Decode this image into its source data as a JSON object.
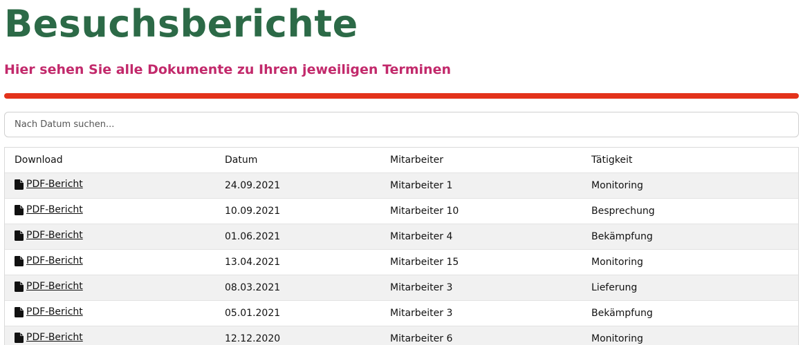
{
  "header": {
    "title": "Besuchsberichte",
    "subtitle": "Hier sehen Sie alle Dokumente zu Ihren jeweiligen Terminen"
  },
  "colors": {
    "title": "#2c6a47",
    "subtitle": "#c2296b",
    "divider": "#e3331b"
  },
  "search": {
    "placeholder": "Nach Datum suchen...",
    "value": ""
  },
  "table": {
    "columns": [
      "Download",
      "Datum",
      "Mitarbeiter",
      "Tätigkeit"
    ],
    "rows": [
      {
        "download": "PDF-Bericht",
        "icon": "file-icon",
        "datum": "24.09.2021",
        "mitarbeiter": "Mitarbeiter 1",
        "taetigkeit": "Monitoring"
      },
      {
        "download": "PDF-Bericht",
        "icon": "file-icon",
        "datum": "10.09.2021",
        "mitarbeiter": "Mitarbeiter 10",
        "taetigkeit": "Besprechung"
      },
      {
        "download": "PDF-Bericht",
        "icon": "file-icon",
        "datum": "01.06.2021",
        "mitarbeiter": "Mitarbeiter 4",
        "taetigkeit": "Bekämpfung"
      },
      {
        "download": "PDF-Bericht",
        "icon": "file-icon",
        "datum": "13.04.2021",
        "mitarbeiter": "Mitarbeiter 15",
        "taetigkeit": "Monitoring"
      },
      {
        "download": "PDF-Bericht",
        "icon": "file-icon",
        "datum": "08.03.2021",
        "mitarbeiter": "Mitarbeiter 3",
        "taetigkeit": "Lieferung"
      },
      {
        "download": "PDF-Bericht",
        "icon": "file-icon",
        "datum": "05.01.2021",
        "mitarbeiter": "Mitarbeiter 3",
        "taetigkeit": "Bekämpfung"
      },
      {
        "download": "PDF-Bericht",
        "icon": "file-icon",
        "datum": "12.12.2020",
        "mitarbeiter": "Mitarbeiter 6",
        "taetigkeit": "Monitoring"
      }
    ]
  }
}
